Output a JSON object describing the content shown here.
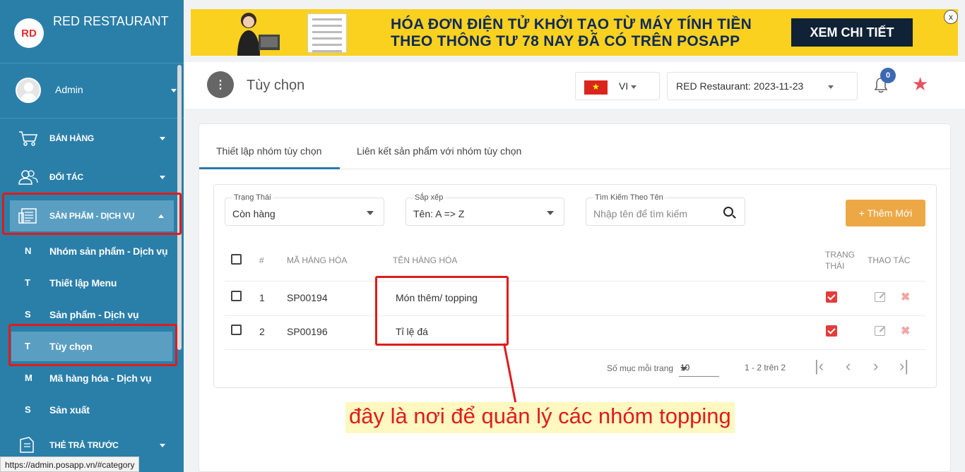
{
  "sidebar": {
    "brand": "RED RESTAURANT",
    "logo_text": "RD",
    "user": "Admin",
    "items": [
      {
        "label": "BÁN HÀNG",
        "icon": "cart-icon"
      },
      {
        "label": "ĐỐI TÁC",
        "icon": "users-icon"
      },
      {
        "label": "SẢN PHẨM - DỊCH VỤ",
        "icon": "catalog-icon"
      },
      {
        "label": "THẺ TRẢ TRƯỚC",
        "icon": "card-icon"
      }
    ],
    "subitems": [
      {
        "letter": "N",
        "label": "Nhóm sản phẩm - Dịch vụ"
      },
      {
        "letter": "T",
        "label": "Thiết lập Menu"
      },
      {
        "letter": "S",
        "label": "Sản phẩm - Dịch vụ"
      },
      {
        "letter": "T",
        "label": "Tùy chọn"
      },
      {
        "letter": "M",
        "label": "Mã hàng hóa - Dịch vụ"
      },
      {
        "letter": "S",
        "label": "Sản xuất"
      }
    ]
  },
  "status_url": "https://admin.posapp.vn/#category",
  "banner": {
    "line1": "HÓA ĐƠN ĐIỆN TỬ KHỞI TẠO TỪ MÁY TÍNH TIỀN",
    "line2": "THEO THÔNG TƯ 78 NAY ĐÃ CÓ TRÊN POSAPP",
    "cta": "XEM CHI TIẾT",
    "close": "x"
  },
  "header": {
    "menu_icon": "⋮",
    "title": "Tùy chọn",
    "lang": "VI",
    "store": "RED Restaurant: 2023-11-23",
    "notifications": "0",
    "star": "★"
  },
  "tabs": [
    "Thiết lập nhóm tùy chọn",
    "Liên kết sản phẩm với nhóm tùy chọn"
  ],
  "filters": {
    "status_label": "Trạng Thái",
    "status_value": "Còn hàng",
    "sort_label": "Sắp xếp",
    "sort_value": "Tên: A => Z",
    "search_label": "Tìm Kiếm Theo Tên",
    "search_placeholder": "Nhập tên để tìm kiếm",
    "add_button": "+ Thêm Mới"
  },
  "table": {
    "headers": {
      "index": "#",
      "code": "MÃ HÀNG HÓA",
      "name": "TÊN HÀNG HÓA",
      "status1": "TRẠNG",
      "status2": "THÁI",
      "actions": "THAO TÁC"
    },
    "rows": [
      {
        "index": "1",
        "code": "SP00194",
        "name": "Món thêm/ topping",
        "active": true
      },
      {
        "index": "2",
        "code": "SP00196",
        "name": "Tỉ lệ đá",
        "active": true
      }
    ]
  },
  "pagination": {
    "per_page_label": "Số mục mỗi trang",
    "per_page": "10",
    "range": "1 - 2 trên 2",
    "first": "|‹",
    "prev": "‹",
    "next": "›",
    "last": "›|"
  },
  "annotation": "đây là nơi để quản lý các nhóm topping",
  "colors": {
    "sidebar": "#2a7fa9",
    "accent": "#eda846",
    "highlight": "#e01b1b",
    "banner": "#fbd11f"
  }
}
